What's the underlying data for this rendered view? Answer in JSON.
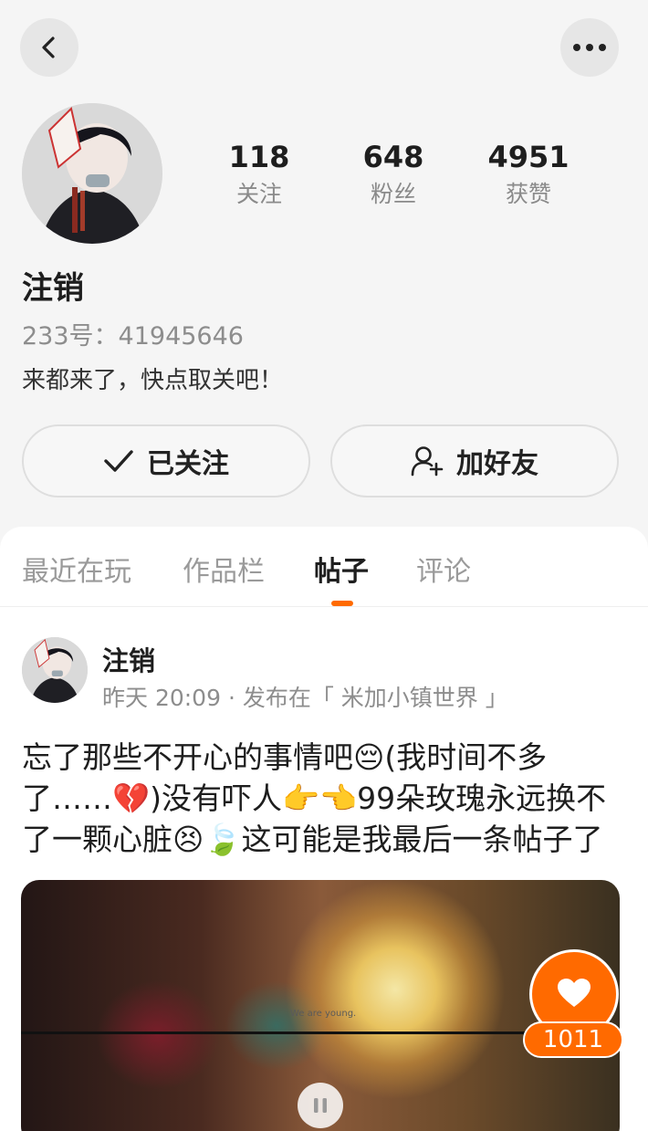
{
  "profile": {
    "username": "注销",
    "uid_text": "233号：41945646",
    "bio": "来都来了，快点取关吧！",
    "stats": [
      {
        "value": "118",
        "label": "关注"
      },
      {
        "value": "648",
        "label": "粉丝"
      },
      {
        "value": "4951",
        "label": "获赞"
      }
    ]
  },
  "actions": {
    "followed_label": "已关注",
    "add_friend_label": "加好友"
  },
  "tabs": [
    {
      "label": "最近在玩",
      "active": false
    },
    {
      "label": "作品栏",
      "active": false
    },
    {
      "label": "帖子",
      "active": true
    },
    {
      "label": "评论",
      "active": false
    }
  ],
  "post": {
    "author": "注销",
    "meta": "昨天 20:09 · 发布在「 米加小镇世界 」",
    "text": "忘了那些不开心的事情吧😔(我时间不多了……💔)没有吓人👉👈99朵玫瑰永远换不了一颗心脏😣🍃这可能是我最后一条帖子了",
    "video_caption": "We are young.",
    "like_count": "1011"
  },
  "colors": {
    "accent": "#ff6a00",
    "background": "#f5f5f5"
  },
  "icons": {
    "back": "chevron-left-icon",
    "more": "more-dots-icon",
    "check": "check-icon",
    "add_friend": "user-plus-icon",
    "pause": "pause-icon",
    "heart": "heart-icon"
  }
}
